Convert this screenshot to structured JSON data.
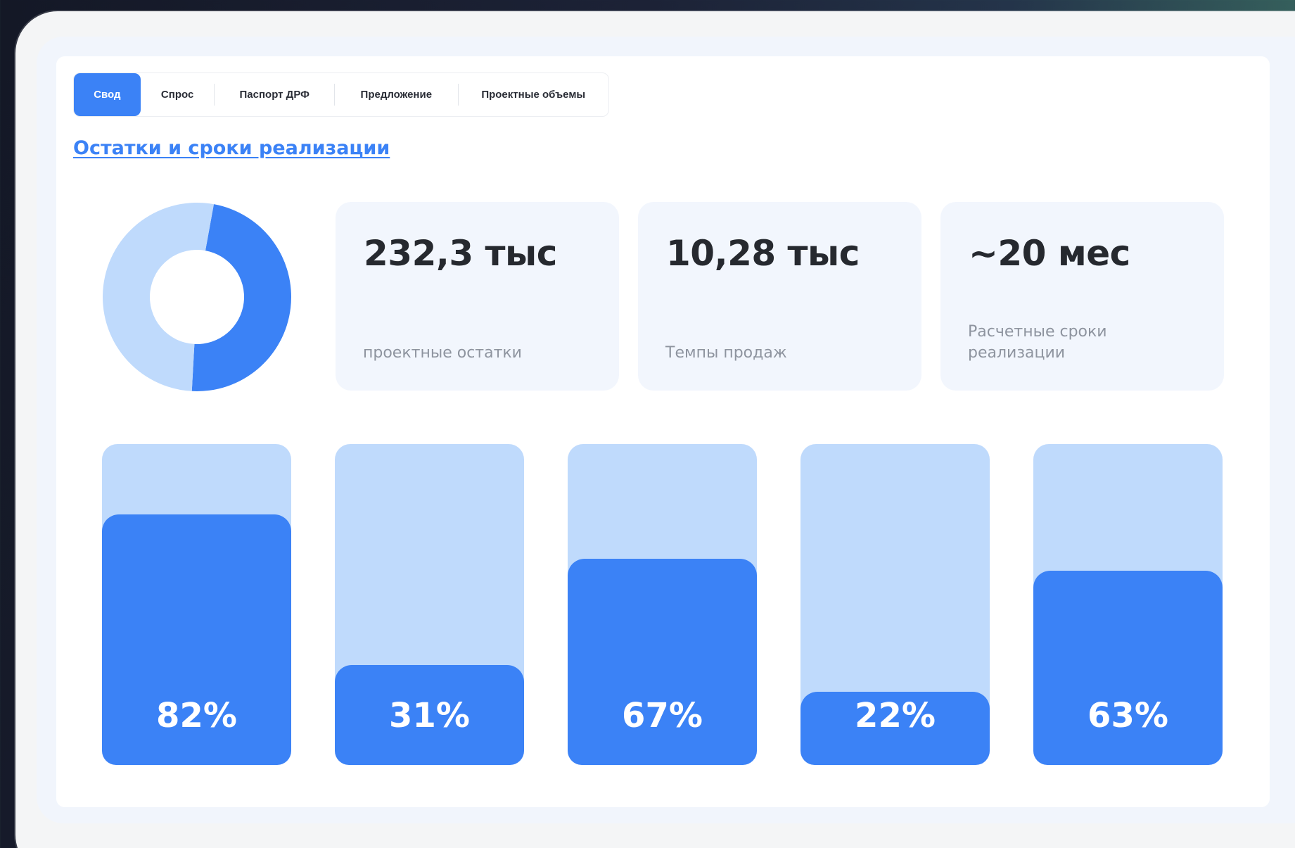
{
  "tabs": [
    {
      "label": "Свод",
      "active": true
    },
    {
      "label": "Спрос",
      "active": false
    },
    {
      "label": "Паспорт ДРФ",
      "active": false
    },
    {
      "label": "Предложение",
      "active": false
    },
    {
      "label": "Проектные объемы",
      "active": false
    }
  ],
  "section": {
    "title": "Остатки и сроки реализации"
  },
  "kpis": [
    {
      "value": "232,3 тыс",
      "label": "проектные остатки"
    },
    {
      "value": "10,28 тыс",
      "label": "Темпы продаж"
    },
    {
      "value": "~20 мес",
      "label": "Расчетные сроки реализации"
    }
  ],
  "colors": {
    "accent": "#3b82f6",
    "light": "#bfdafc",
    "kpi_bg": "#f2f6fd"
  },
  "chart_data": [
    {
      "type": "pie",
      "donut": true,
      "values": [
        48,
        52
      ],
      "colors": [
        "#3b82f6",
        "#bfdafc"
      ]
    },
    {
      "type": "bar",
      "values": [
        82,
        31,
        67,
        22,
        63
      ],
      "labels": [
        "82%",
        "31%",
        "67%",
        "22%",
        "63%"
      ],
      "ylim": [
        0,
        100
      ]
    }
  ]
}
